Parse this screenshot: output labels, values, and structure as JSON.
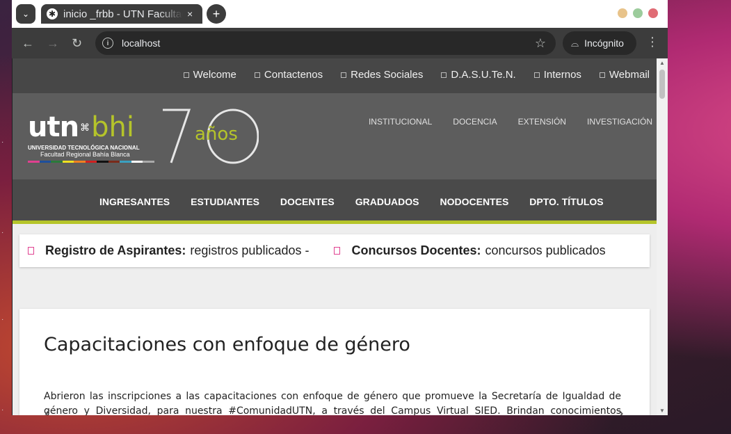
{
  "browser": {
    "tab_title": "inicio _frbb - UTN Facultad Regional Bahía Blanca",
    "tab_close": "×",
    "new_tab": "+",
    "url": "localhost",
    "incognito_label": "Incógnito",
    "colors": {
      "tabbar": "#ffffff",
      "toolbar": "#3c3c3c",
      "omnibox": "#282828"
    }
  },
  "site": {
    "topbar_links": [
      "Welcome",
      "Contactenos",
      "Redes Sociales",
      "D.A.S.U.Te.N.",
      "Internos",
      "Webmail"
    ],
    "logo": {
      "utn": "utn",
      "bhi": "bhi",
      "line1": "UNIVERSIDAD TECNOLÓGICA NACIONAL",
      "line2": "Facultad Regional Bahía Blanca",
      "anniversary": "años"
    },
    "header_nav": [
      "INSTITUCIONAL",
      "DOCENCIA",
      "EXTENSIÓN",
      "INVESTIGACIÓN"
    ],
    "main_nav": [
      "INGRESANTES",
      "ESTUDIANTES",
      "DOCENTES",
      "GRADUADOS",
      "NODOCENTES",
      "DPTO. TÍTULOS"
    ],
    "ticker": [
      {
        "bold": "Registro de Aspirantes:",
        "text": "registros publicados -"
      },
      {
        "bold": "Concursos Docentes:",
        "text": "concursos publicados"
      }
    ],
    "article": {
      "title": "Capacitaciones con enfoque de género",
      "body": "Abrieron las inscripciones a las capacitaciones con enfoque de género que promueve la Secretaría de Igualdad de género y Diversidad, para nuestra #ComunidadUTN, a través del Campus Virtual SIED. Brindan conocimientos específicos, herramientas"
    },
    "colors": {
      "accent": "#b5c42a",
      "topbar": "#474747",
      "header": "#5d5d5d",
      "mainnav": "#4a4a4a",
      "ticker_marker": "#e04090"
    }
  }
}
